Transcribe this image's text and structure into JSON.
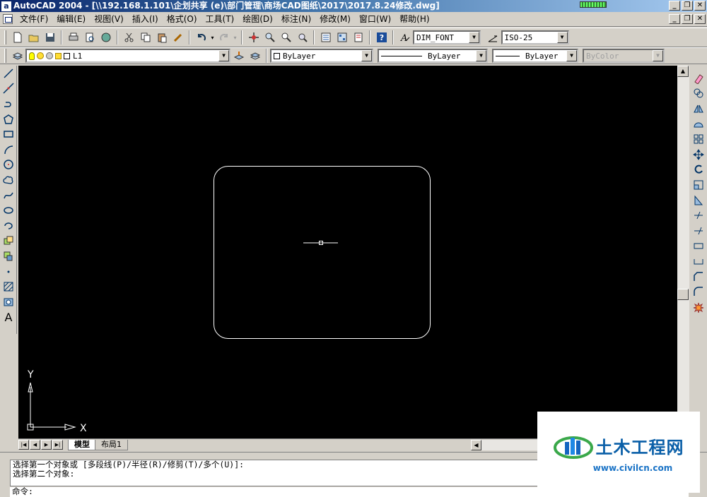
{
  "window": {
    "title": "AutoCAD 2004 - [\\\\192.168.1.101\\企划共享 (e)\\部门管理\\商场CAD图纸\\2017\\2017.8.24修改.dwg]",
    "app_icon_letter": "a",
    "controls": [
      "minimize",
      "restore",
      "close"
    ]
  },
  "menubar": {
    "items": [
      "文件(F)",
      "编辑(E)",
      "视图(V)",
      "插入(I)",
      "格式(O)",
      "工具(T)",
      "绘图(D)",
      "标注(N)",
      "修改(M)",
      "窗口(W)",
      "帮助(H)"
    ]
  },
  "standard_toolbar": {
    "text_style": "DIM_FONT",
    "dim_style": "ISO-25"
  },
  "layers_toolbar": {
    "current_layer": "L1",
    "color": "ByLayer",
    "linetype": "ByLayer",
    "lineweight": "ByLayer",
    "plot_style": "ByColor"
  },
  "layout_tabs": {
    "tabs": [
      "模型",
      "布局1"
    ],
    "active": "模型"
  },
  "ucs": {
    "x_label": "X",
    "y_label": "Y"
  },
  "command_window": {
    "history_line_1": "选择第一个对象或 [多段线(P)/半径(R)/修剪(T)/多个(U)]:",
    "history_line_2": "选择第二个对象:",
    "prompt": "命令:"
  },
  "watermark": {
    "title": "土木工程网",
    "url": "www.civilcn.com"
  },
  "colors": {
    "canvas_bg": "#000000",
    "title_gradient_start": "#0a246a",
    "ui_face": "#d4d0c8",
    "watermark_blue": "#0a5fa8"
  }
}
